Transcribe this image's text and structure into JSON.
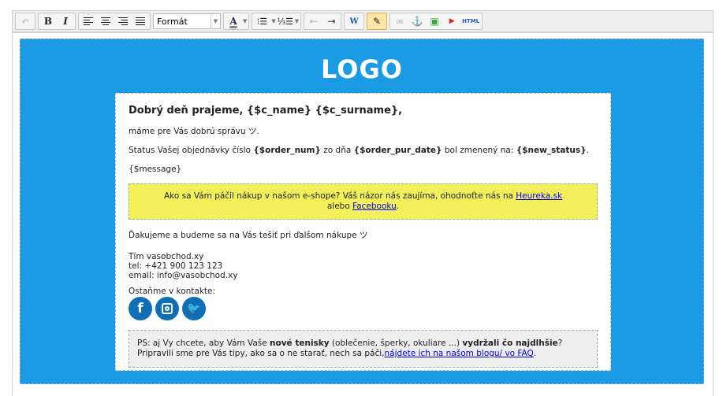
{
  "toolbar": {
    "undo": "↶",
    "bold": "B",
    "italic": "I",
    "format": "Formát",
    "font_color": "A",
    "html": "HTML"
  },
  "email": {
    "logo": "LOGO",
    "greeting": "Dobrý deň prajeme, {$c_name} {$c_surname},",
    "good_news": "máme pre Vás dobrú správu ツ.",
    "status_pre": "Status Vašej objednávky číslo ",
    "order_num": "{$order_num}",
    "status_mid": " zo dňa ",
    "order_date": "{$order_pur_date}",
    "status_mid2": " bol zmenený na: ",
    "new_status": "{$new_status}",
    "status_end": ".",
    "message": "{$message}",
    "review_text": "Ako sa Vám páčil nákup v našom e-shope? Váš názor nás zaujíma, ohodnoťte nás na ",
    "review_link1": "Heureka.sk",
    "review_or": "alebo ",
    "review_link2": "Facebooku",
    "review_end": ".",
    "thanks": "Ďakujeme a budeme sa na Vás tešiť pri ďalšom nákupe ツ",
    "team": "Tím vasobchod.xy",
    "tel": "tel: +421 900 123 123",
    "email": "email: info@vasobchod.xy",
    "contact": "Ostaňme v kontakte:",
    "ps_1": "PS: aj Vy chcete, aby Vám Vaše ",
    "ps_b1": "nové tenisky",
    "ps_2": " (oblečenie, šperky, okuliare ...) ",
    "ps_b2": "vydržali čo najdlhšie",
    "ps_3": "?",
    "ps_4": "Pripravili sme pre Vás tipy, ako sa o ne starať, nech sa páči,",
    "ps_link": "nájdete ich na našom blogu/ vo FAQ",
    "ps_end": "."
  },
  "colors": {
    "background": "#1a9be3",
    "review_box": "#f4f05a",
    "ps_box": "#eeeeee",
    "social": "#0f6eb6"
  }
}
